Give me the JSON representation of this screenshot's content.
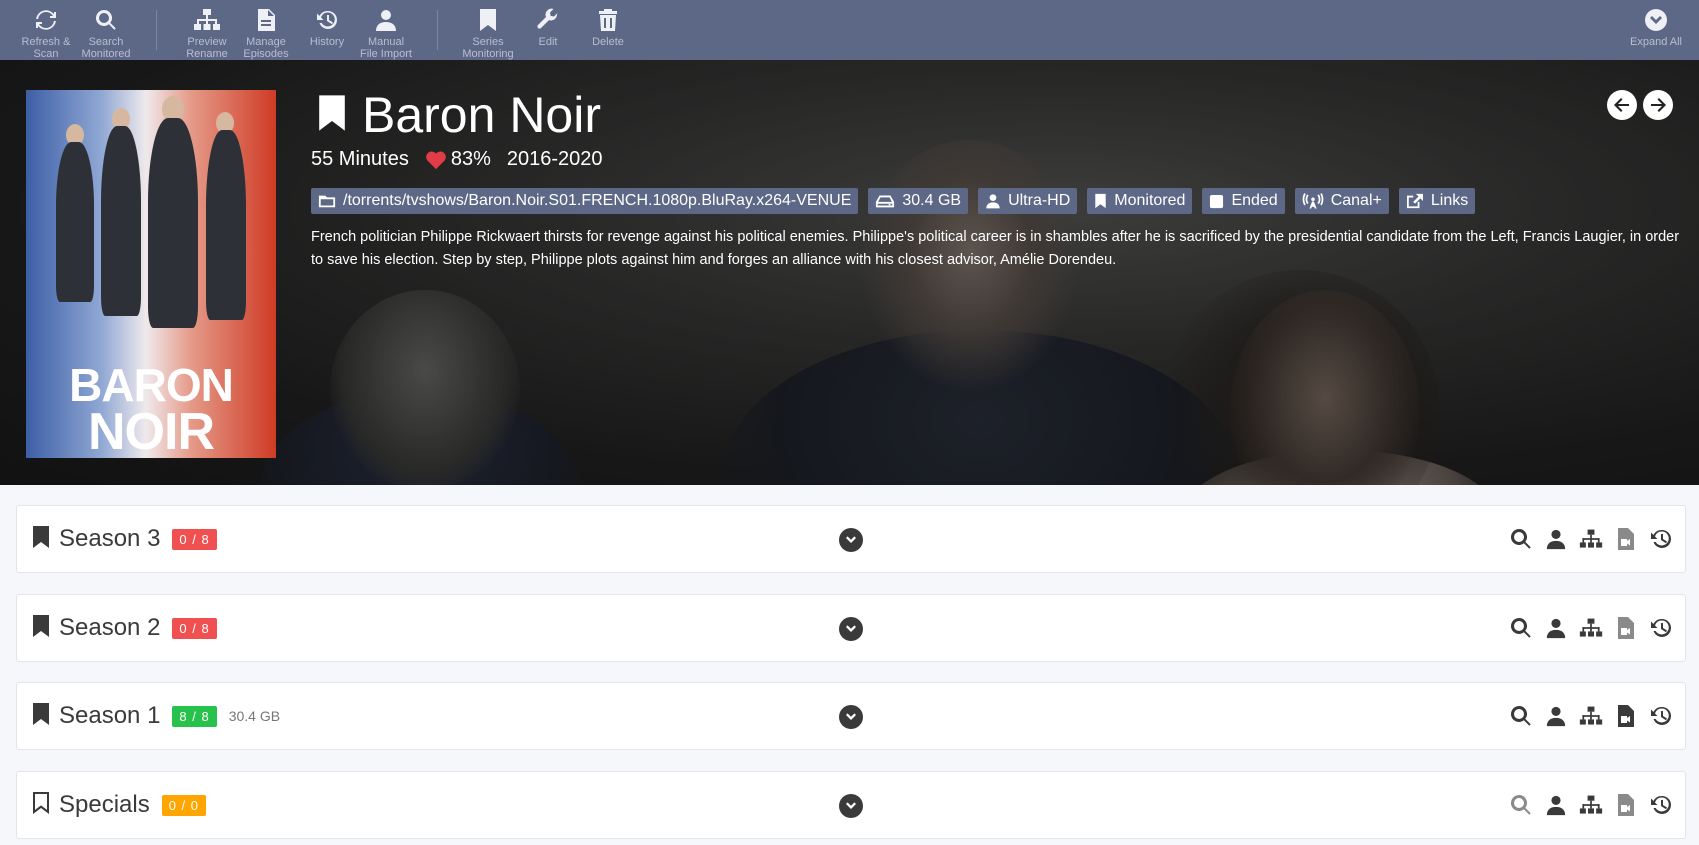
{
  "toolbar": {
    "refresh_scan": "Refresh &\nScan",
    "search_monitored": "Search\nMonitored",
    "preview_rename": "Preview\nRename",
    "manage_episodes": "Manage\nEpisodes",
    "history": "History",
    "manual_import": "Manual\nFile Import",
    "series_monitoring": "Series\nMonitoring",
    "edit": "Edit",
    "delete": "Delete",
    "expand_all": "Expand All"
  },
  "series": {
    "title": "Baron Noir",
    "runtime": "55 Minutes",
    "rating": "83%",
    "years": "2016-2020",
    "path": "/torrents/tvshows/Baron.Noir.S01.FRENCH.1080p.BluRay.x264-VENUE",
    "size": "30.4 GB",
    "quality_profile": "Ultra-HD",
    "monitored": "Monitored",
    "status": "Ended",
    "network": "Canal+",
    "links": "Links",
    "overview": "French politician Philippe Rickwaert thirsts for revenge against his political enemies. Philippe's political career is in shambles after he is sacrificed by the presidential candidate from the Left, Francis Laugier, in order to save his election. Step by step, Philippe plots against him and forges an alliance with his closest advisor, Amélie Dorendeu.",
    "poster_line1": "BARON",
    "poster_line2": "NOIR"
  },
  "seasons": [
    {
      "name": "Season 3",
      "count": "0 / 8",
      "size": ""
    },
    {
      "name": "Season 2",
      "count": "0 / 8",
      "size": ""
    },
    {
      "name": "Season 1",
      "count": "8 / 8",
      "size": "30.4 GB"
    },
    {
      "name": "Specials",
      "count": "0 / 0",
      "size": ""
    }
  ],
  "colors": {
    "toolbar_bg": "#5d6786",
    "badge_missing": "#f05050",
    "badge_complete": "#27c24c",
    "badge_empty": "#ffa500",
    "rating_heart": "#e23c46"
  },
  "icons": {
    "toolbar": [
      "refresh-icon",
      "search-icon",
      "sitemap-icon",
      "file-icon",
      "history-icon",
      "user-icon",
      "bookmark-icon",
      "wrench-icon",
      "trash-icon",
      "chevron-circle-down-icon"
    ],
    "season_actions": [
      "search-icon",
      "user-icon",
      "sitemap-icon",
      "file-video-icon",
      "history-icon"
    ]
  }
}
